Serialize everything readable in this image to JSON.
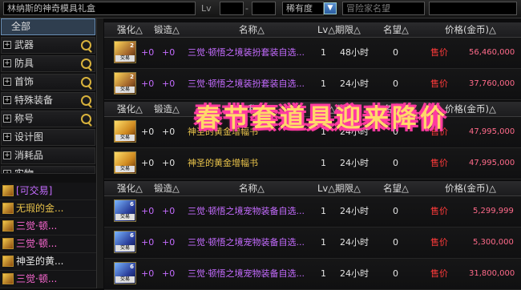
{
  "search": {
    "name_value": "林纳斯的神奇模具礼盒",
    "lv_label": "Lv",
    "lv_dash": "-",
    "rarity_value": "稀有度",
    "dropdown_glyph": "▼",
    "adventurer_placeholder": "冒险家名望"
  },
  "sidebar": {
    "categories": [
      {
        "label": "全部",
        "selected": true
      },
      {
        "label": "武器"
      },
      {
        "label": "防具"
      },
      {
        "label": "首饰"
      },
      {
        "label": "特殊装备"
      },
      {
        "label": "称号"
      },
      {
        "label": "设计图"
      },
      {
        "label": "消耗品"
      },
      {
        "label": "实物"
      }
    ],
    "results": [
      {
        "label": "[可交易]",
        "color": "purple"
      },
      {
        "label": "无瑕的金...",
        "color": "gold"
      },
      {
        "label": "三觉·顿...",
        "color": "pink"
      },
      {
        "label": "三觉·顿...",
        "color": "pink"
      },
      {
        "label": "神圣的黄...",
        "color": "white"
      },
      {
        "label": "三觉·顿...",
        "color": "pink"
      }
    ]
  },
  "columns": {
    "enhance": "强化△",
    "forge": "锻造△",
    "name": "名称△",
    "lv": "Lv△",
    "period": "期限△",
    "fame": "名望△",
    "price": "价格(金币)△"
  },
  "rows": [
    {
      "icon": "box-gold",
      "badge": "交易",
      "num": "2",
      "enhance": "+0",
      "forge": "+0",
      "name": "三觉·顿悟之境装扮套装自选...",
      "name_color": "c-purple",
      "lv": "1",
      "period": "48小时",
      "fame": "0",
      "sale": "售价",
      "price": "56,460,000"
    },
    {
      "icon": "box-gold",
      "badge": "交易",
      "num": "2",
      "enhance": "+0",
      "forge": "+0",
      "name": "三觉·顿悟之境装扮套装自选...",
      "name_color": "c-purple",
      "lv": "1",
      "period": "24小时",
      "fame": "0",
      "sale": "售价",
      "price": "37,760,000"
    },
    {
      "icon": "scroll-gold",
      "badge": "交易",
      "num": "",
      "enhance": "+0",
      "forge": "+0",
      "name": "神圣的黄金增幅书",
      "name_color": "c-gold",
      "lv": "1",
      "period": "24小时",
      "fame": "0",
      "sale": "售价",
      "price": "47,995,000"
    },
    {
      "icon": "scroll-gold",
      "badge": "交易",
      "num": "",
      "enhance": "+0",
      "forge": "+0",
      "name": "神圣的黄金增幅书",
      "name_color": "c-gold",
      "lv": "1",
      "period": "24小时",
      "fame": "0",
      "sale": "售价",
      "price": "47,995,000"
    },
    {
      "icon": "box-pet",
      "badge": "交易",
      "num": "6",
      "enhance": "+0",
      "forge": "+0",
      "name": "三觉·顿悟之境宠物装备自选...",
      "name_color": "c-purple",
      "lv": "1",
      "period": "24小时",
      "fame": "0",
      "sale": "售价",
      "price": "5,299,999"
    },
    {
      "icon": "box-pet",
      "badge": "交易",
      "num": "6",
      "enhance": "+0",
      "forge": "+0",
      "name": "三觉·顿悟之境宠物装备自选...",
      "name_color": "c-purple",
      "lv": "1",
      "period": "24小时",
      "fame": "0",
      "sale": "售价",
      "price": "5,300,000"
    },
    {
      "icon": "box-pet",
      "badge": "交易",
      "num": "6",
      "enhance": "+0",
      "forge": "+0",
      "name": "三觉·顿悟之境宠物装备自选...",
      "name_color": "c-purple",
      "lv": "1",
      "period": "24小时",
      "fame": "0",
      "sale": "售价",
      "price": "31,800,000"
    }
  ],
  "banner": "春节套道具迎来降价"
}
